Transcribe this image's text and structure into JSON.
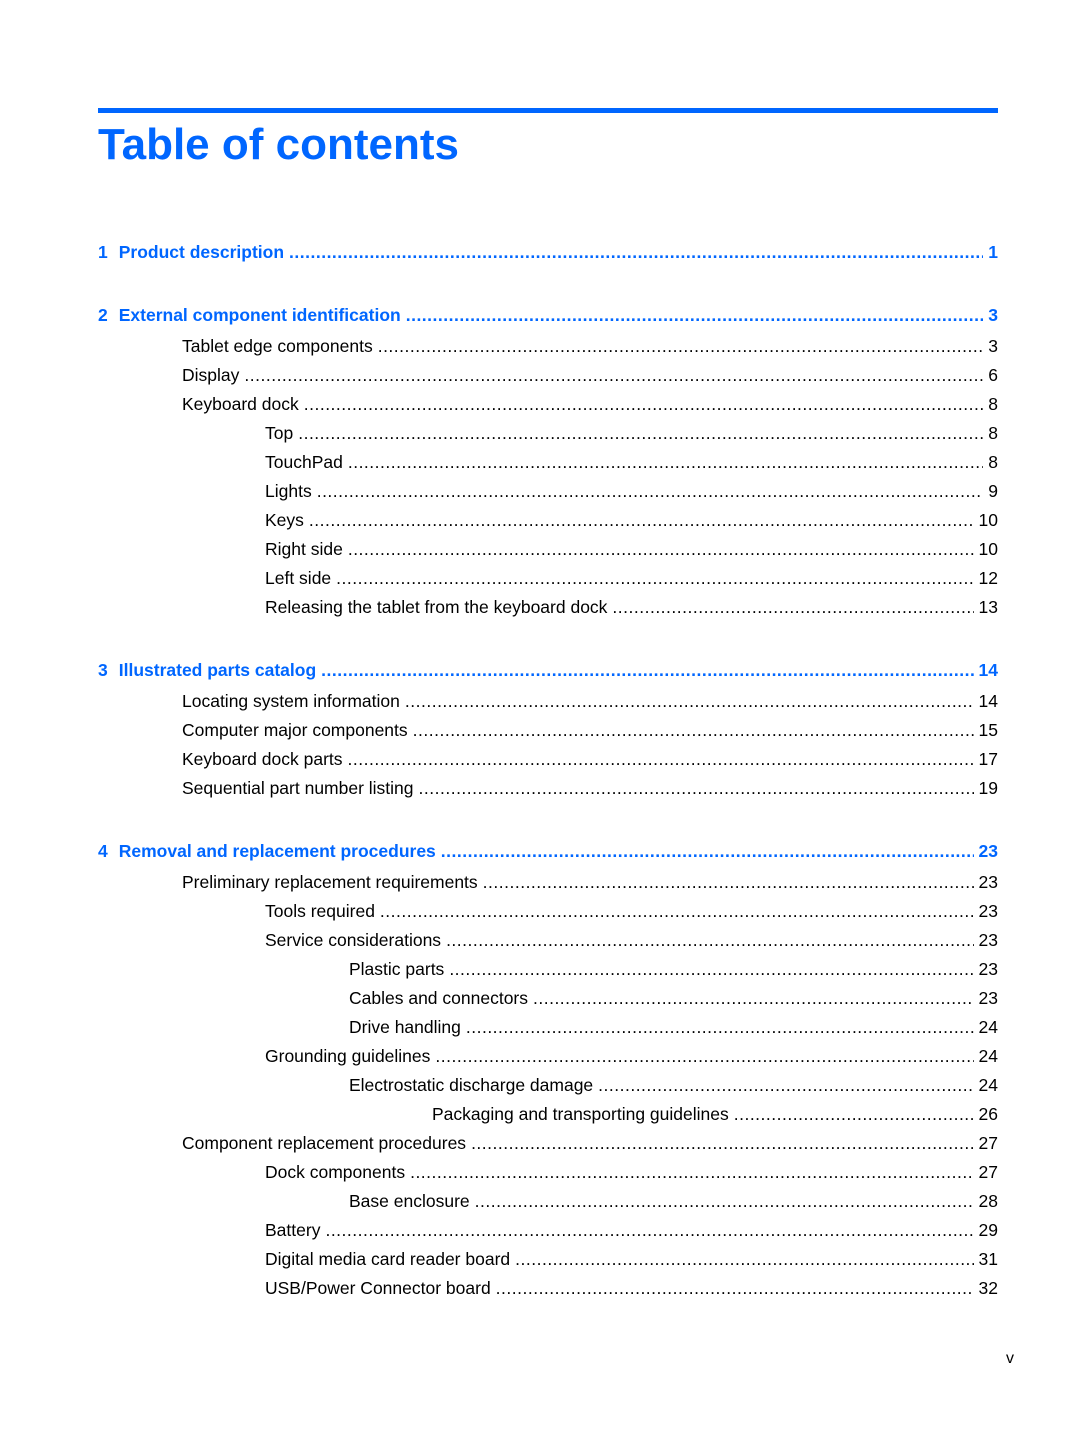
{
  "title": "Table of contents",
  "accent_color": "#0066ff",
  "footer_page": "v",
  "entries": [
    {
      "level": 1,
      "num": "1",
      "text": "Product description",
      "page": "1"
    },
    {
      "level": 1,
      "num": "2",
      "text": "External component identification",
      "page": "3"
    },
    {
      "level": 2,
      "text": "Tablet edge components",
      "page": "3"
    },
    {
      "level": 2,
      "text": "Display",
      "page": "6"
    },
    {
      "level": 2,
      "text": "Keyboard dock",
      "page": "8"
    },
    {
      "level": 3,
      "text": "Top",
      "page": "8"
    },
    {
      "level": 3,
      "text": "TouchPad",
      "page": "8"
    },
    {
      "level": 3,
      "text": "Lights",
      "page": "9"
    },
    {
      "level": 3,
      "text": "Keys",
      "page": "10"
    },
    {
      "level": 3,
      "text": "Right side",
      "page": "10"
    },
    {
      "level": 3,
      "text": "Left side",
      "page": "12"
    },
    {
      "level": 3,
      "text": "Releasing the tablet from the keyboard dock",
      "page": "13"
    },
    {
      "level": 1,
      "num": "3",
      "text": "Illustrated parts catalog",
      "page": "14"
    },
    {
      "level": 2,
      "text": "Locating system information",
      "page": "14"
    },
    {
      "level": 2,
      "text": "Computer major components",
      "page": "15"
    },
    {
      "level": 2,
      "text": "Keyboard dock parts",
      "page": "17"
    },
    {
      "level": 2,
      "text": "Sequential part number listing",
      "page": "19"
    },
    {
      "level": 1,
      "num": "4",
      "text": "Removal and replacement procedures",
      "page": "23"
    },
    {
      "level": 2,
      "text": "Preliminary replacement requirements",
      "page": "23"
    },
    {
      "level": 3,
      "text": "Tools required",
      "page": "23"
    },
    {
      "level": 3,
      "text": "Service considerations",
      "page": "23"
    },
    {
      "level": 4,
      "text": "Plastic parts",
      "page": "23"
    },
    {
      "level": 4,
      "text": "Cables and connectors",
      "page": "23"
    },
    {
      "level": 4,
      "text": "Drive handling",
      "page": "24"
    },
    {
      "level": 3,
      "text": "Grounding guidelines",
      "page": "24"
    },
    {
      "level": 4,
      "text": "Electrostatic discharge damage",
      "page": "24"
    },
    {
      "level": 5,
      "text": "Packaging and transporting guidelines",
      "page": "26"
    },
    {
      "level": 2,
      "text": "Component replacement procedures",
      "page": "27"
    },
    {
      "level": 3,
      "text": "Dock components",
      "page": "27"
    },
    {
      "level": 4,
      "text": "Base enclosure",
      "page": "28"
    },
    {
      "level": 3,
      "text": "Battery",
      "page": "29"
    },
    {
      "level": 3,
      "text": "Digital media card reader board",
      "page": "31"
    },
    {
      "level": 3,
      "text": "USB/Power Connector board",
      "page": "32"
    }
  ]
}
